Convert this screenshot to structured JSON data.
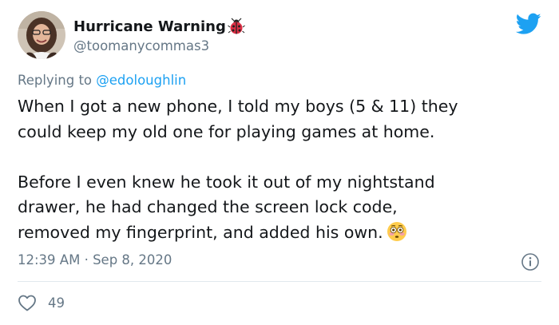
{
  "author": {
    "display_name": "Hurricane Warning",
    "handle": "@toomanycommas3",
    "name_emoji": "ladybug-icon"
  },
  "reply": {
    "prefix": "Replying to ",
    "to": "@edoloughlin"
  },
  "body": {
    "line1": "When I got a new phone, I told my boys (5 & 11) they",
    "line2": "could keep my old one for playing games at home.",
    "line3": "Before I even knew he took it out of my nightstand",
    "line4": "drawer, he had changed the screen lock code,",
    "line5": "removed my fingerprint, and added his own.",
    "end_emoji": "flushed-face-icon"
  },
  "meta": {
    "time": "12:39 AM",
    "separator": " · ",
    "date": "Sep 8, 2020"
  },
  "stats": {
    "likes": "49"
  },
  "colors": {
    "brand": "#1da1f2",
    "muted": "#657786",
    "text": "#14171a",
    "divider": "#e1e8ed"
  }
}
